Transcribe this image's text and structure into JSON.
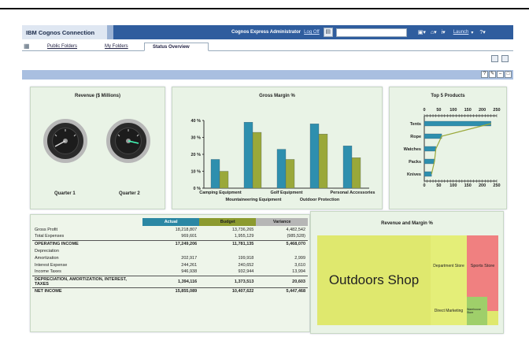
{
  "header": {
    "app_title": "IBM Cognos Connection",
    "user": "Cognos Express Administrator",
    "logoff": "Log Off",
    "launch": "Launch"
  },
  "tabs": [
    "Public Folders",
    "My Folders",
    "Status Overview"
  ],
  "revenue": {
    "title": "Revenue ($ Millions)",
    "gauge1_label": "Quarter 1",
    "gauge2_label": "Quarter 2"
  },
  "gross_margin": {
    "title": "Gross Margin %"
  },
  "top_products": {
    "title": "Top 5 Products"
  },
  "financials": {
    "headers": [
      "Actual",
      "Budget",
      "Variance"
    ],
    "rows": [
      {
        "label": "Gross Profit",
        "actual": "18,218,807",
        "budget": "13,736,265",
        "variance": "4,482,542",
        "style": ""
      },
      {
        "label": "Total Expenses",
        "actual": "969,601",
        "budget": "1,955,129",
        "variance": "(985,528)",
        "style": ""
      },
      {
        "label": "OPERATING INCOME",
        "actual": "17,249,206",
        "budget": "11,781,135",
        "variance": "5,468,070",
        "style": "sep bold"
      },
      {
        "label": "Depreciation",
        "actual": "",
        "budget": "",
        "variance": "",
        "style": ""
      },
      {
        "label": "Amortization",
        "actual": "202,917",
        "budget": "199,918",
        "variance": "2,999",
        "style": ""
      },
      {
        "label": "Interest Expense",
        "actual": "244,261",
        "budget": "240,652",
        "variance": "3,610",
        "style": ""
      },
      {
        "label": "Income Taxes",
        "actual": "946,938",
        "budget": "932,944",
        "variance": "13,994",
        "style": ""
      },
      {
        "label": "DEPRECIATION, AMORTIZATION, INTEREST, TAXES",
        "actual": "1,394,116",
        "budget": "1,373,513",
        "variance": "20,603",
        "style": "sep bold"
      },
      {
        "label": "NET INCOME",
        "actual": "15,855,089",
        "budget": "10,407,622",
        "variance": "5,447,468",
        "style": "sep bold"
      }
    ]
  },
  "treemap": {
    "title": "Revenue and Margin %",
    "cells": [
      "Outdoors Shop",
      "Department Store",
      "Sports Store",
      "Direct Marketing",
      "Warehouse Store"
    ]
  },
  "chart_data": [
    {
      "type": "bar",
      "title": "Gross Margin %",
      "categories": [
        "Camping Equipment",
        "Mountaineering Equipment",
        "Golf Equipment",
        "Outdoor Protection",
        "Personal Accessories"
      ],
      "series": [
        {
          "values": [
            17,
            39,
            23,
            38,
            25
          ],
          "color": "#2e8fae"
        },
        {
          "values": [
            10,
            33,
            17,
            32,
            18
          ],
          "color": "#9aa83a"
        }
      ],
      "yticks": [
        "0 %",
        "10 %",
        "20 %",
        "30 %",
        "40 %"
      ],
      "ylim": [
        0,
        40
      ]
    },
    {
      "type": "bar",
      "title": "Top 5 Products",
      "categories": [
        "Tents",
        "Rope",
        "Watches",
        "Packs",
        "Knives"
      ],
      "values": [
        230,
        60,
        40,
        35,
        25
      ],
      "xticks": [
        "0",
        "50",
        "100",
        "150",
        "200",
        "250"
      ],
      "xlim": [
        0,
        250
      ],
      "color": "#2e8fae",
      "line_color": "#9aa83a"
    }
  ]
}
